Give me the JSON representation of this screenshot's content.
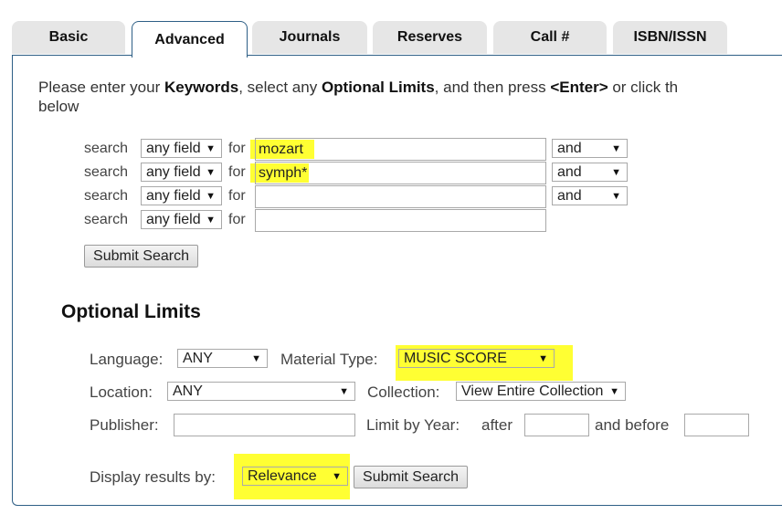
{
  "tabs": [
    "Basic",
    "Advanced",
    "Journals",
    "Reserves",
    "Call #",
    "ISBN/ISSN"
  ],
  "intro": {
    "p1": "Please enter your ",
    "keywords": "Keywords",
    "p2": ", select any ",
    "optional": "Optional Limits",
    "p3": ", and then press ",
    "enter": "<Enter>",
    "p4": " or click th",
    "line2": "below"
  },
  "search_rows": [
    {
      "search_label": "search",
      "field": "any field",
      "for_label": "for",
      "value": "mozart",
      "bool": "and"
    },
    {
      "search_label": "search",
      "field": "any field",
      "for_label": "for",
      "value": "symph*",
      "bool": "and"
    },
    {
      "search_label": "search",
      "field": "any field",
      "for_label": "for",
      "value": "",
      "bool": "and"
    },
    {
      "search_label": "search",
      "field": "any field",
      "for_label": "for",
      "value": ""
    }
  ],
  "submit_label": "Submit Search",
  "limits": {
    "heading": "Optional Limits",
    "language_label": "Language:",
    "language_value": "ANY",
    "material_label": "Material Type:",
    "material_value": "MUSIC SCORE",
    "location_label": "Location:",
    "location_value": "ANY",
    "collection_label": "Collection:",
    "collection_value": "View Entire Collection",
    "publisher_label": "Publisher:",
    "publisher_value": "",
    "year_label": "Limit by Year:",
    "after_label": "after",
    "after_value": "",
    "before_label": "and before",
    "before_value": "",
    "display_label": "Display results by:",
    "display_value": "Relevance",
    "submit_label": "Submit Search"
  },
  "colors": {
    "highlight": "#ffff33",
    "border": "#2e5f86",
    "tab_bg": "#e6e6e6"
  },
  "icons": {
    "dropdown": "triangle-down-icon"
  }
}
